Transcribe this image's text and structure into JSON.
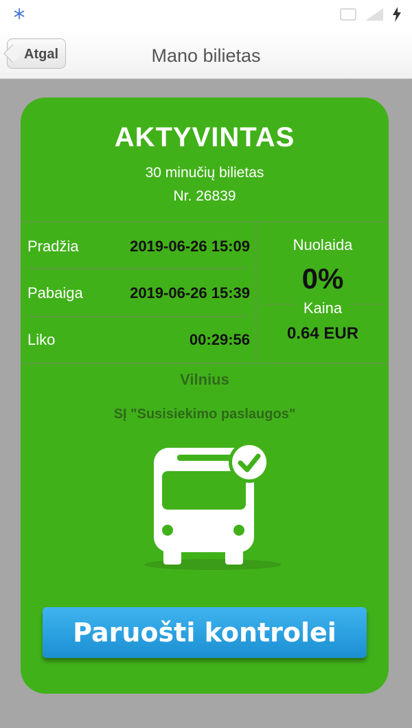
{
  "nav": {
    "back_label": "Atgal",
    "title": "Mano bilietas"
  },
  "ticket": {
    "status": "AKTYVINTAS",
    "type": "30 minučių bilietas",
    "number": "Nr. 26839",
    "rows": [
      {
        "label": "Pradžia",
        "value": "2019-06-26 15:09"
      },
      {
        "label": "Pabaiga",
        "value": "2019-06-26 15:39"
      },
      {
        "label": "Liko",
        "value": "00:29:56"
      }
    ],
    "discount_label": "Nuolaida",
    "discount_value": "0%",
    "price_label": "Kaina",
    "price_value": "0.64 EUR",
    "city": "Vilnius",
    "operator": "SĮ \"Susisiekimo paslaugos\""
  },
  "action": {
    "button_label": "Paruošti kontrolei"
  },
  "colors": {
    "card_green": "#41b11a",
    "button_blue": "#1b8fd2"
  }
}
